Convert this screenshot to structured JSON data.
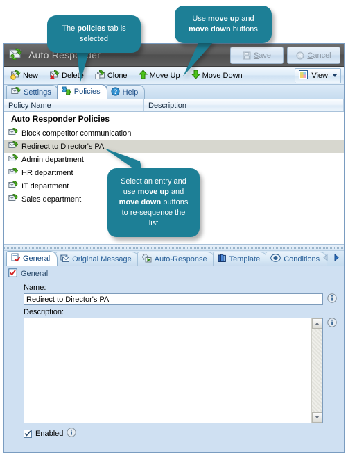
{
  "window": {
    "title": "Auto Responder",
    "app_icon": "mail-arrows-icon"
  },
  "titlebar_buttons": [
    {
      "label": "Save",
      "accesskey": "S",
      "icon": "floppy-disk-icon",
      "disabled": true
    },
    {
      "label": "Cancel",
      "accesskey": "C",
      "icon": "cancel-circle-icon",
      "disabled": true
    }
  ],
  "toolbar": {
    "items": [
      {
        "label": "New",
        "icon": "new-policy-icon"
      },
      {
        "label": "Delete",
        "icon": "delete-policy-icon"
      },
      {
        "label": "Clone",
        "icon": "clone-policy-icon"
      },
      {
        "label": "Move Up",
        "icon": "arrow-up-icon"
      },
      {
        "label": "Move Down",
        "icon": "arrow-down-icon"
      }
    ],
    "view_button": {
      "label": "View",
      "icon": "view-palette-icon",
      "caret": "chevron-down-icon"
    }
  },
  "main_tabs": [
    {
      "label": "Settings",
      "icon": "settings-icon",
      "selected": false
    },
    {
      "label": "Policies",
      "icon": "policies-puzzle-icon",
      "selected": true
    },
    {
      "label": "Help",
      "icon": "help-question-icon",
      "selected": false
    }
  ],
  "list": {
    "columns": [
      {
        "label": "Policy Name"
      },
      {
        "label": "Description"
      }
    ],
    "group_header": "Auto Responder Policies",
    "rows": [
      {
        "name": "Block competitor communication",
        "description": "",
        "icon": "policy-icon",
        "selected": false
      },
      {
        "name": "Redirect to Director's PA",
        "description": "",
        "icon": "policy-icon",
        "selected": true
      },
      {
        "name": "Admin department",
        "description": "",
        "icon": "policy-icon",
        "selected": false
      },
      {
        "name": "HR department",
        "description": "",
        "icon": "policy-icon",
        "selected": false
      },
      {
        "name": "IT department",
        "description": "",
        "icon": "policy-icon",
        "selected": false
      },
      {
        "name": "Sales department",
        "description": "",
        "icon": "policy-icon",
        "selected": false
      }
    ]
  },
  "detail": {
    "tabs": [
      {
        "label": "General",
        "icon": "general-icon",
        "selected": true
      },
      {
        "label": "Original Message",
        "icon": "message-icon",
        "selected": false
      },
      {
        "label": "Auto-Response",
        "icon": "auto-response-icon",
        "selected": false
      },
      {
        "label": "Template",
        "icon": "template-books-icon",
        "selected": false
      },
      {
        "label": "Conditions",
        "icon": "conditions-icon",
        "selected": false
      }
    ],
    "nav": {
      "prev": "left-arrow-icon",
      "next": "right-arrow-icon",
      "prev_disabled": true,
      "next_disabled": false
    },
    "group_label": "General",
    "group_icon": "general-checkbox-icon",
    "name_field": {
      "label": "Name:",
      "value": "Redirect to Director's PA",
      "placeholder": "",
      "info_icon": "info-icon"
    },
    "description_field": {
      "label": "Description:",
      "value": "",
      "placeholder": "",
      "info_icon": "info-icon",
      "scroll_up_icon": "scroll-up-icon",
      "scroll_down_icon": "scroll-down-icon"
    },
    "enabled": {
      "label": "Enabled",
      "checked": true,
      "info_icon": "info-icon"
    }
  },
  "callouts": [
    {
      "id": "callout-policies-tab",
      "line1_pre": "The ",
      "line1_bold": "policies",
      "line1_post": " tab is",
      "line2": "selected"
    },
    {
      "id": "callout-move-buttons",
      "line1_pre": "Use ",
      "line1_bold": "move up",
      "line1_post": " and",
      "line2_bold": "move down",
      "line2_post": " buttons"
    },
    {
      "id": "callout-resequence",
      "l1": "Select an entry and",
      "l2_pre": "use  ",
      "l2_bold": "move up",
      "l2_post": " and",
      "l3_bold": "move down",
      "l3_post": " buttons",
      "l4": "to re-sequence the",
      "l5": "list"
    }
  ],
  "colors": {
    "callout_teal": "#1d7f96",
    "titlebar_gray": "#5b5b5b",
    "pane_blue": "#cfe0f2",
    "selection_gray": "#d7d7cf",
    "accent_blue": "#1a4c86"
  }
}
